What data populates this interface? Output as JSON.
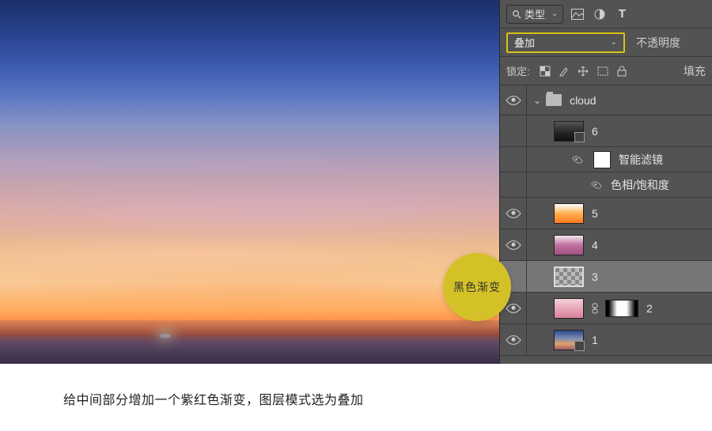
{
  "filter": {
    "label": "类型"
  },
  "blend": {
    "mode": "叠加",
    "opacity_label": "不透明度"
  },
  "lock": {
    "label": "锁定:",
    "fill_label": "填充"
  },
  "callout": {
    "text": "黑色渐变"
  },
  "layers": {
    "group": {
      "name": "cloud"
    },
    "l6": {
      "name": "6"
    },
    "smart": {
      "label": "智能滤镜"
    },
    "hs": {
      "label": "色相/饱和度"
    },
    "l5": {
      "name": "5"
    },
    "l4": {
      "name": "4"
    },
    "l3": {
      "name": "3"
    },
    "l2": {
      "name": "2"
    },
    "l1": {
      "name": "1"
    }
  },
  "caption": "给中间部分增加一个紫红色渐变，图层模式选为叠加"
}
